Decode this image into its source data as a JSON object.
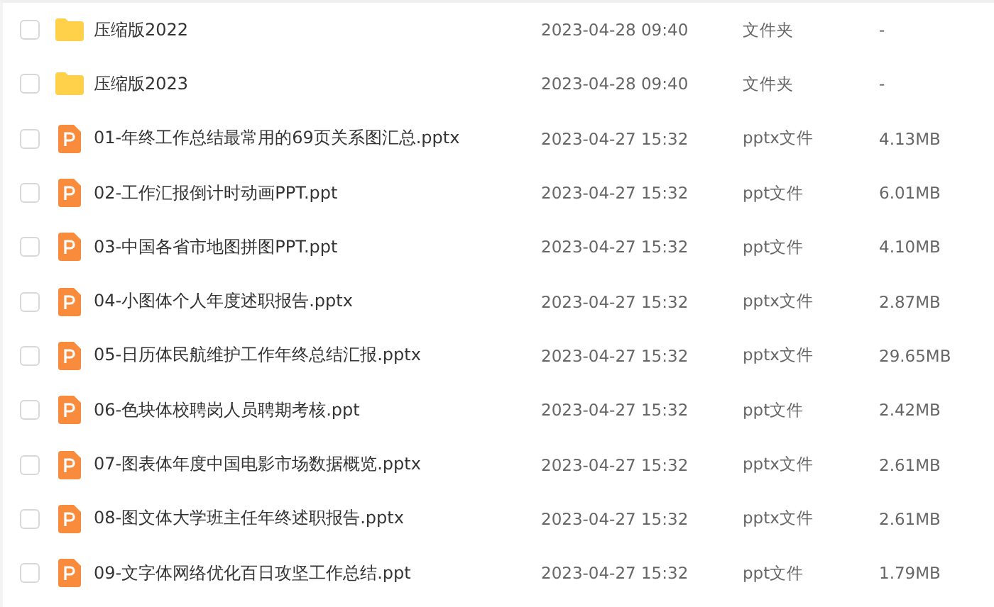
{
  "files": [
    {
      "kind": "folder",
      "checked": false,
      "name": "压缩版2022",
      "modified": "2023-04-28 09:40",
      "type": "文件夹",
      "size": "-"
    },
    {
      "kind": "folder",
      "checked": false,
      "name": "压缩版2023",
      "modified": "2023-04-28 09:40",
      "type": "文件夹",
      "size": "-"
    },
    {
      "kind": "ppt",
      "checked": false,
      "name": "01-年终工作总结最常用的69页关系图汇总.pptx",
      "modified": "2023-04-27 15:32",
      "type": "pptx文件",
      "size": "4.13MB"
    },
    {
      "kind": "ppt",
      "checked": false,
      "name": "02-工作汇报倒计时动画PPT.ppt",
      "modified": "2023-04-27 15:32",
      "type": "ppt文件",
      "size": "6.01MB"
    },
    {
      "kind": "ppt",
      "checked": false,
      "name": "03-中国各省市地图拼图PPT.ppt",
      "modified": "2023-04-27 15:32",
      "type": "ppt文件",
      "size": "4.10MB"
    },
    {
      "kind": "ppt",
      "checked": false,
      "name": "04-小图体个人年度述职报告.pptx",
      "modified": "2023-04-27 15:32",
      "type": "pptx文件",
      "size": "2.87MB"
    },
    {
      "kind": "ppt",
      "checked": false,
      "name": "05-日历体民航维护工作年终总结汇报.pptx",
      "modified": "2023-04-27 15:32",
      "type": "pptx文件",
      "size": "29.65MB"
    },
    {
      "kind": "ppt",
      "checked": false,
      "name": "06-色块体校聘岗人员聘期考核.ppt",
      "modified": "2023-04-27 15:32",
      "type": "ppt文件",
      "size": "2.42MB"
    },
    {
      "kind": "ppt",
      "checked": false,
      "name": "07-图表体年度中国电影市场数据概览.pptx",
      "modified": "2023-04-27 15:32",
      "type": "pptx文件",
      "size": "2.61MB"
    },
    {
      "kind": "ppt",
      "checked": false,
      "name": "08-图文体大学班主任年终述职报告.pptx",
      "modified": "2023-04-27 15:32",
      "type": "pptx文件",
      "size": "2.61MB"
    },
    {
      "kind": "ppt",
      "checked": false,
      "name": "09-文字体网络优化百日攻坚工作总结.ppt",
      "modified": "2023-04-27 15:32",
      "type": "ppt文件",
      "size": "1.79MB"
    }
  ]
}
